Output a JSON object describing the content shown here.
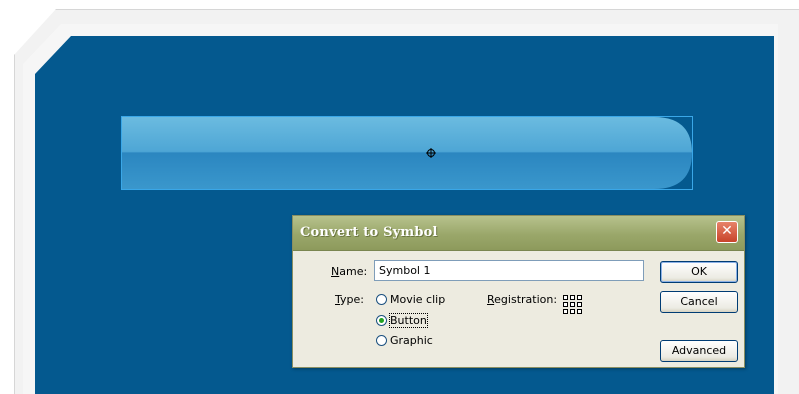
{
  "dialog": {
    "title": "Convert to Symbol",
    "close_glyph": "✕",
    "name_label_underline": "N",
    "name_label_rest": "ame:",
    "name_value": "Symbol 1",
    "type_label_underline": "T",
    "type_label_rest": "ype:",
    "type_options": [
      {
        "label": "Movie clip",
        "checked": false
      },
      {
        "label": "Button",
        "checked": true
      },
      {
        "label": "Graphic",
        "checked": false
      }
    ],
    "registration_label_underline": "R",
    "registration_label_rest": "egistration:",
    "buttons": {
      "ok": "OK",
      "cancel": "Cancel",
      "advanced": "Advanced"
    }
  },
  "colors": {
    "stage": "#04598f",
    "button_top": "#5aaed8",
    "button_bottom": "#2583bd",
    "dialog_titlebar": "#9aa76a"
  }
}
